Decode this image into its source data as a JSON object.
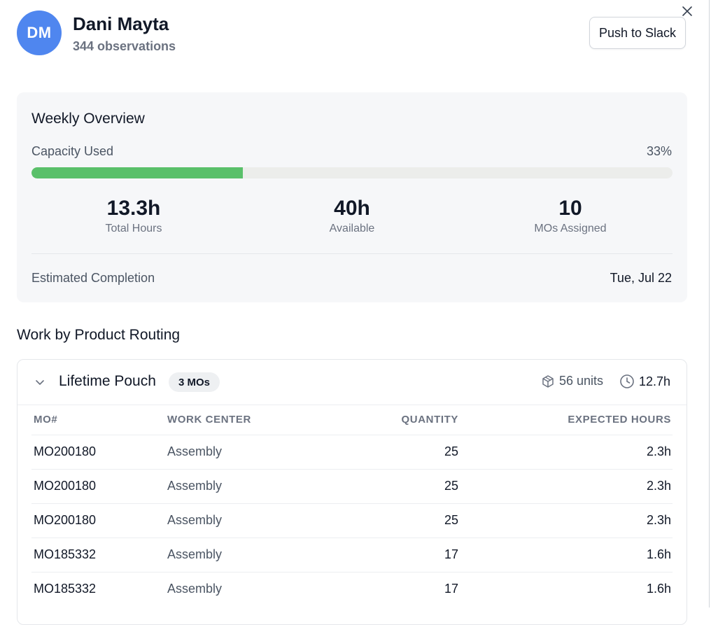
{
  "header": {
    "avatar_initials": "DM",
    "avatar_color": "#4f86ef",
    "name": "Dani Mayta",
    "subtitle": "344 observations",
    "push_button": "Push to Slack",
    "close_icon": "close-icon"
  },
  "overview": {
    "title": "Weekly Overview",
    "capacity_label": "Capacity Used",
    "capacity_pct_text": "33%",
    "capacity_fraction": 0.33,
    "bar_color": "#5ac06a",
    "stats": [
      {
        "value": "13.3h",
        "label": "Total Hours"
      },
      {
        "value": "40h",
        "label": "Available"
      },
      {
        "value": "10",
        "label": "MOs Assigned"
      }
    ],
    "completion_label": "Estimated Completion",
    "completion_value": "Tue, Jul 22"
  },
  "routing": {
    "section_title": "Work by Product Routing",
    "group": {
      "name": "Lifetime Pouch",
      "badge": "3 MOs",
      "units": "56 units",
      "hours": "12.7h",
      "expanded": true
    },
    "columns": [
      "MO#",
      "WORK CENTER",
      "QUANTITY",
      "EXPECTED HOURS"
    ],
    "rows": [
      {
        "mo": "MO200180",
        "work_center": "Assembly",
        "quantity": "25",
        "hours": "2.3h"
      },
      {
        "mo": "MO200180",
        "work_center": "Assembly",
        "quantity": "25",
        "hours": "2.3h"
      },
      {
        "mo": "MO200180",
        "work_center": "Assembly",
        "quantity": "25",
        "hours": "2.3h"
      },
      {
        "mo": "MO185332",
        "work_center": "Assembly",
        "quantity": "17",
        "hours": "1.6h"
      },
      {
        "mo": "MO185332",
        "work_center": "Assembly",
        "quantity": "17",
        "hours": "1.6h"
      }
    ]
  }
}
